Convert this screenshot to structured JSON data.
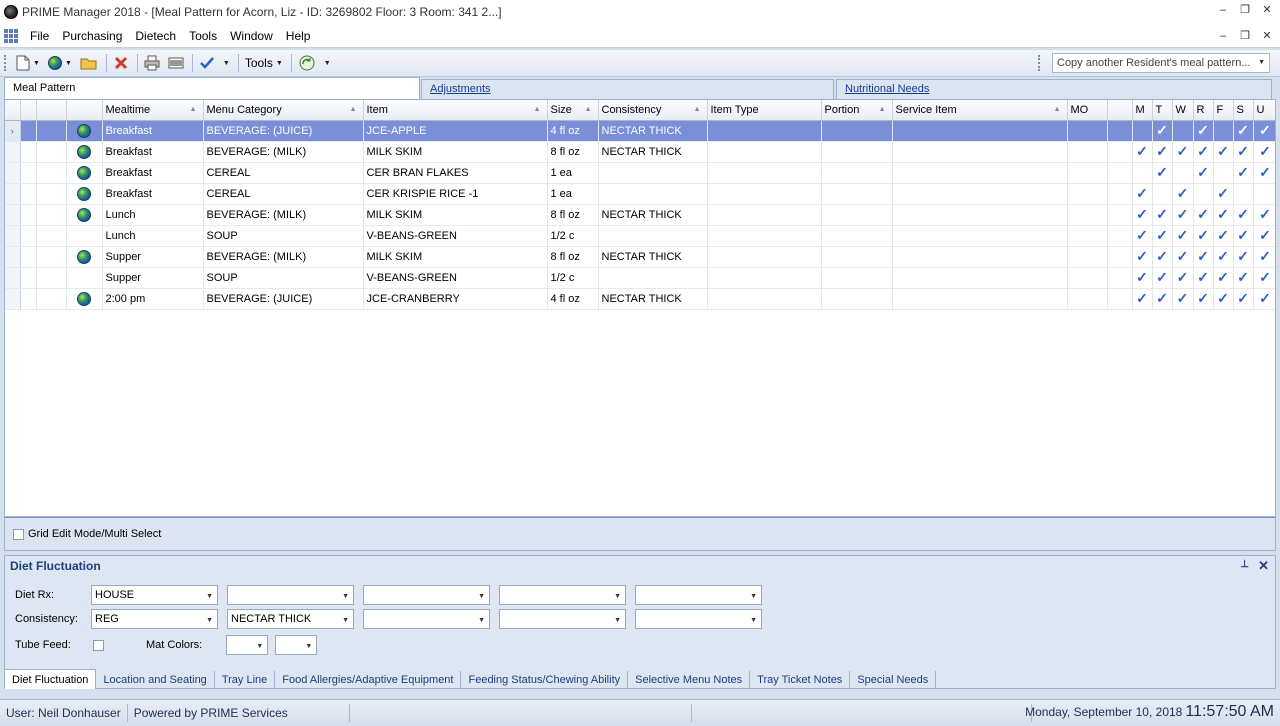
{
  "window": {
    "title": "PRIME Manager 2018 - [Meal Pattern for Acorn, Liz - ID: 3269802 Floor: 3 Room: 341 2...]",
    "minimize_glyph": "–",
    "restore_glyph": "❐",
    "close_glyph": "✕"
  },
  "menu": {
    "items": [
      "File",
      "Purchasing",
      "Dietech",
      "Tools",
      "Window",
      "Help"
    ]
  },
  "toolbar": {
    "tools_label": "Tools",
    "copy_placeholder": "Copy another Resident's meal pattern..."
  },
  "tabs": {
    "meal_pattern": "Meal Pattern",
    "adjustments": "Adjustments",
    "nutritional_needs": "Nutritional Needs"
  },
  "grid": {
    "columns": {
      "mealtime": "Mealtime",
      "menu_category": "Menu Category",
      "item": "Item",
      "size": "Size",
      "consistency": "Consistency",
      "item_type": "Item Type",
      "portion": "Portion",
      "service_item": "Service Item",
      "mo": "MO",
      "days": [
        "M",
        "T",
        "W",
        "R",
        "F",
        "S",
        "U"
      ]
    },
    "check_glyph": "✓",
    "row_pointer_glyph": "›",
    "rows": [
      {
        "globe": true,
        "mealtime": "Breakfast",
        "category": "BEVERAGE: (JUICE)",
        "item": "JCE-APPLE",
        "size": "4 fl oz",
        "consistency": "NECTAR THICK",
        "days": [
          false,
          true,
          false,
          true,
          false,
          true,
          true
        ],
        "selected": true,
        "group_start": false
      },
      {
        "globe": true,
        "mealtime": "Breakfast",
        "category": "BEVERAGE: (MILK)",
        "item": "MILK SKIM",
        "size": "8 fl oz",
        "consistency": "NECTAR THICK",
        "days": [
          true,
          true,
          true,
          true,
          true,
          true,
          true
        ],
        "selected": false,
        "group_start": false
      },
      {
        "globe": true,
        "mealtime": "Breakfast",
        "category": "CEREAL",
        "item": "CER BRAN FLAKES",
        "size": "1 ea",
        "consistency": "",
        "days": [
          false,
          true,
          false,
          true,
          false,
          true,
          true
        ],
        "selected": false,
        "group_start": false
      },
      {
        "globe": true,
        "mealtime": "Breakfast",
        "category": "CEREAL",
        "item": "CER KRISPIE RICE -1",
        "size": "1 ea",
        "consistency": "",
        "days": [
          true,
          false,
          true,
          false,
          true,
          false,
          false
        ],
        "selected": false,
        "group_start": false
      },
      {
        "globe": true,
        "mealtime": "Lunch",
        "category": "BEVERAGE: (MILK)",
        "item": "MILK SKIM",
        "size": "8 fl oz",
        "consistency": "NECTAR THICK",
        "days": [
          true,
          true,
          true,
          true,
          true,
          true,
          true
        ],
        "selected": false,
        "group_start": true
      },
      {
        "globe": false,
        "mealtime": "Lunch",
        "category": "SOUP",
        "item": "V-BEANS-GREEN",
        "size": "1/2 c",
        "consistency": "",
        "days": [
          true,
          true,
          true,
          true,
          true,
          true,
          true
        ],
        "selected": false,
        "group_start": false
      },
      {
        "globe": true,
        "mealtime": "Supper",
        "category": "BEVERAGE: (MILK)",
        "item": "MILK SKIM",
        "size": "8 fl oz",
        "consistency": "NECTAR THICK",
        "days": [
          true,
          true,
          true,
          true,
          true,
          true,
          true
        ],
        "selected": false,
        "group_start": true
      },
      {
        "globe": false,
        "mealtime": "Supper",
        "category": "SOUP",
        "item": "V-BEANS-GREEN",
        "size": "1/2 c",
        "consistency": "",
        "days": [
          true,
          true,
          true,
          true,
          true,
          true,
          true
        ],
        "selected": false,
        "group_start": false
      },
      {
        "globe": true,
        "mealtime": "2:00 pm",
        "category": "BEVERAGE: (JUICE)",
        "item": "JCE-CRANBERRY",
        "size": "4 fl oz",
        "consistency": "NECTAR THICK",
        "days": [
          true,
          true,
          true,
          true,
          true,
          true,
          true
        ],
        "selected": false,
        "group_start": true
      }
    ],
    "grid_edit_label": "Grid Edit Mode/Multi Select"
  },
  "diet": {
    "title": "Diet Fluctuation",
    "diet_rx_label": "Diet Rx:",
    "diet_rx_values": [
      "HOUSE",
      "",
      "",
      "",
      ""
    ],
    "consistency_label": "Consistency:",
    "consistency_values": [
      "REG",
      "NECTAR THICK",
      "",
      "",
      ""
    ],
    "tube_feed_label": "Tube Feed:",
    "mat_colors_label": "Mat Colors:",
    "pin_glyph": "📌",
    "close_glyph": "✕"
  },
  "bottom_tabs": [
    "Diet Fluctuation",
    "Location and Seating",
    "Tray Line",
    "Food Allergies/Adaptive Equipment",
    "Feeding Status/Chewing Ability",
    "Selective Menu Notes",
    "Tray Ticket Notes",
    "Special Needs"
  ],
  "status": {
    "user": "User: Neil Donhauser",
    "powered": "Powered by PRIME Services Technology",
    "date": "Monday, September 10, 2018",
    "time": "11:57:50 AM"
  },
  "colors": {
    "selected_row": "#7b8fd8",
    "check": "#2a61c2",
    "panel_header": "#1e3f7a"
  }
}
